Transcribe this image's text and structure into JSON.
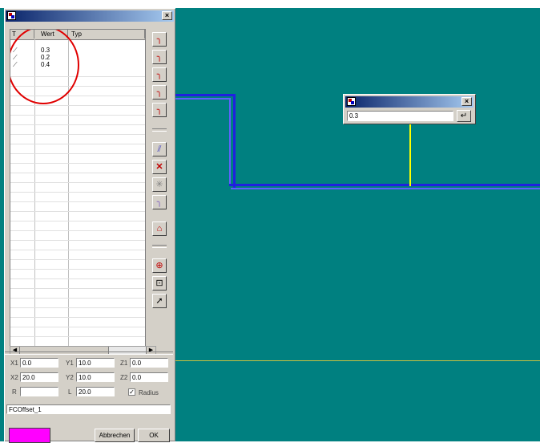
{
  "list": {
    "headers": [
      "T",
      "Wert",
      "Typ"
    ],
    "rows": [
      {
        "icon": "curve-icon",
        "value": ""
      },
      {
        "icon": "curve-icon",
        "value": "0.3"
      },
      {
        "icon": "curve-icon",
        "value": "0.2"
      },
      {
        "icon": "curve-icon",
        "value": "0.4"
      }
    ]
  },
  "fields": {
    "x1": {
      "label": "X1",
      "value": "0.0"
    },
    "y1": {
      "label": "Y1",
      "value": "10.0"
    },
    "z1": {
      "label": "Z1",
      "value": "0.0"
    },
    "x2": {
      "label": "X2",
      "value": "20.0"
    },
    "y2": {
      "label": "Y2",
      "value": "10.0"
    },
    "z2": {
      "label": "Z2",
      "value": "0.0"
    },
    "r": {
      "label": "R",
      "value": ""
    },
    "l": {
      "label": "L",
      "value": "20.0"
    },
    "radius": {
      "label": "Radius",
      "checked": true
    }
  },
  "name_field": "FCOffset_1",
  "buttons": {
    "cancel": "Abbrechen",
    "ok": "OK"
  },
  "dialog": {
    "input": "0.3"
  },
  "colors": {
    "swatch": "#ff00ff",
    "canvas": "#008080",
    "titlebar": "#0a246a"
  }
}
